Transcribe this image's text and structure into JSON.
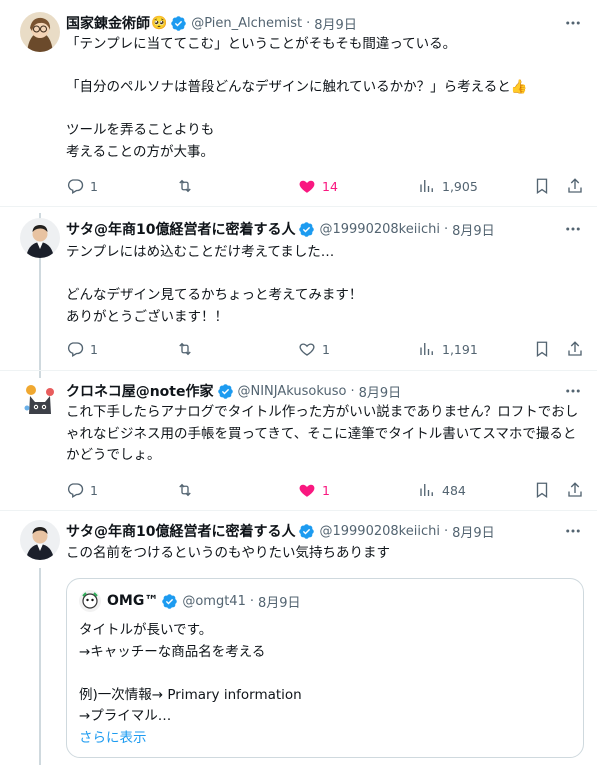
{
  "colors": {
    "text": "#0f1419",
    "secondary": "#536471",
    "like": "#f91880",
    "verified": "#1d9bf0",
    "link": "#1d9bf0"
  },
  "tweets": [
    {
      "name": "国家錬金術師",
      "emoji": "🥺",
      "handle": "@Pien_Alchemist",
      "date": "8月9日",
      "lines": [
        "「テンプレに当ててこむ」ということがそもそも間違っている。",
        "",
        "「自分のペルソナは普段どんなデザインに触れているかか？」ら考えると👍",
        "",
        "ツールを弄ることよりも",
        "考えることの方が大事。"
      ],
      "replies": "1",
      "likes": "14",
      "views": "1,905",
      "liked": true
    },
    {
      "name": "サタ@年商10億経営者に密着する人",
      "handle": "@19990208keiichi",
      "date": "8月9日",
      "lines": [
        "テンプレにはめ込むことだけ考えてました…",
        "",
        "どんなデザイン見てるかちょっと考えてみます！",
        "ありがとうございます！！"
      ],
      "replies": "1",
      "likes": "1",
      "views": "1,191",
      "liked": false
    },
    {
      "name": "クロネコ屋@note作家",
      "handle": "@NINJAkusokuso",
      "date": "8月9日",
      "text": "これ下手したらアナログでタイトル作った方がいい説までありません？ロフトでおしゃれなビジネス用の手帳を買ってきて、そこに達筆でタイトル書いてスマホで撮るとかどうでしょ。",
      "replies": "1",
      "likes": "1",
      "views": "484",
      "liked": true
    },
    {
      "name": "サタ@年商10億経営者に密着する人",
      "handle": "@19990208keiichi",
      "date": "8月9日",
      "lines": [
        "この名前をつけるというのもやりたい気持ちあります"
      ],
      "quote": {
        "name": "OMG™",
        "handle": "@omgt41",
        "date": "8月9日",
        "lines": [
          "タイトルが長いです。",
          "→キャッチーな商品名を考える",
          "",
          "例)一次情報→ Primary information",
          "→プライマル…"
        ],
        "show_more": "さらに表示"
      }
    }
  ],
  "separator": "·",
  "icons": [
    "verified-badge-icon",
    "more-icon",
    "reply-icon",
    "retweet-icon",
    "like-icon",
    "views-icon",
    "bookmark-icon",
    "share-icon"
  ]
}
